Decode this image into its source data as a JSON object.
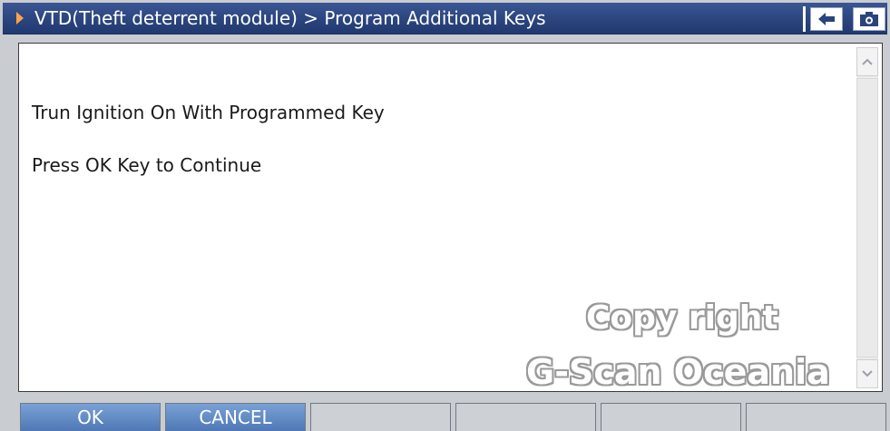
{
  "title_bar": {
    "title": "VTD(Theft deterrent module) > Program Additional Keys",
    "icons": [
      "play-arrow-icon",
      "back-arrow-icon",
      "camera-icon"
    ]
  },
  "content": {
    "lines": [
      "Trun Ignition On With Programmed Key",
      "Press OK Key to Continue"
    ]
  },
  "watermark": {
    "line1": "Copy right",
    "line2": "G-Scan Oceania"
  },
  "buttons": {
    "ok": "OK",
    "cancel": "CANCEL"
  },
  "colors": {
    "title_bar": "#2a437c",
    "active_button": "#5a84c0",
    "arrow": "#ffa24a"
  }
}
